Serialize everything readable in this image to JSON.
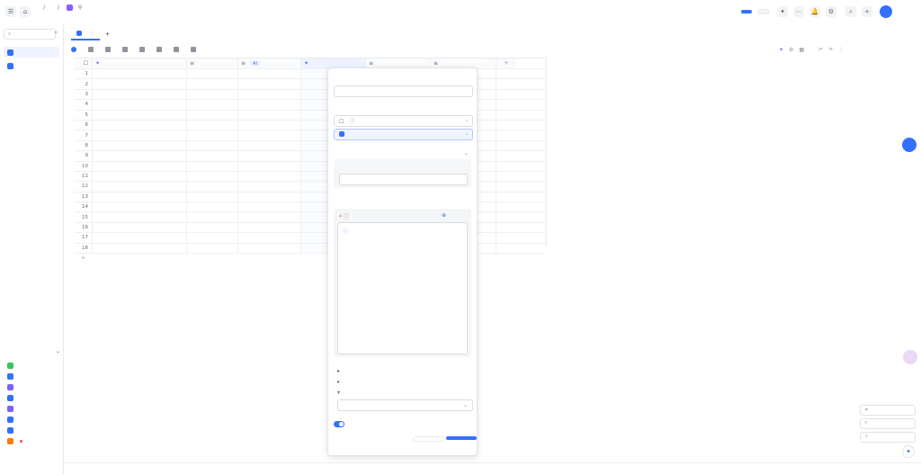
{
  "header": {
    "breadcrumb_1": "",
    "breadcrumb_2": "",
    "doc_title": "",
    "doc_subtitle_1": "",
    "doc_subtitle_2": "",
    "share_label": "",
    "auto_label": "",
    "user_avatar_text": ""
  },
  "sidebar": {
    "search_placeholder": "",
    "items": [
      {
        "label": ""
      },
      {
        "label": ""
      }
    ],
    "new_section_label": "",
    "new_items": [
      {
        "label": ""
      },
      {
        "label": ""
      },
      {
        "label": ""
      },
      {
        "label": ""
      },
      {
        "label": ""
      },
      {
        "label": ""
      },
      {
        "label": ""
      },
      {
        "label": ""
      }
    ]
  },
  "workarea": {
    "tab_active": "",
    "tab_new": "",
    "toolbar": [
      "",
      "",
      "",
      "",
      "",
      "",
      "",
      "",
      ""
    ],
    "toolbar_right": "",
    "columns": [
      "",
      "",
      "",
      "",
      "",
      ""
    ],
    "rows": [
      {
        "id": "1",
        "c1": "",
        "c2": "",
        "c3": "",
        "c6": ""
      },
      {
        "id": "2",
        "c1": "",
        "c2": "",
        "c3": "",
        "c6": ""
      },
      {
        "id": "3",
        "c1": "",
        "c2": "",
        "c3": "",
        "c6": ""
      },
      {
        "id": "4",
        "c1": "",
        "c2": "",
        "c3": "",
        "c6": ""
      },
      {
        "id": "5",
        "c1": "",
        "c2": "",
        "c3": "",
        "c6": ""
      },
      {
        "id": "6",
        "c1": "",
        "c2": "",
        "c3": "",
        "c6": ""
      },
      {
        "id": "7",
        "c1": "",
        "c2": "",
        "c3": "",
        "c6": ""
      },
      {
        "id": "8",
        "c1": "",
        "c2": "",
        "c3": "",
        "c6": ""
      },
      {
        "id": "9",
        "c1": "",
        "c2": "",
        "c3": "",
        "c6": ""
      },
      {
        "id": "10",
        "c1": "",
        "c2": "",
        "c3": "",
        "c6": ""
      },
      {
        "id": "11",
        "c1": "",
        "c2": "",
        "c3": "",
        "c6": ""
      },
      {
        "id": "12",
        "c1": "",
        "c2": "",
        "c3": "",
        "c6": ""
      },
      {
        "id": "13",
        "c1": "",
        "c2": "",
        "c3": "",
        "c6": ""
      },
      {
        "id": "14",
        "c1": "",
        "c2": "",
        "c3": "",
        "c6": ""
      },
      {
        "id": "15",
        "c1": "",
        "c2": "",
        "c3": "",
        "c6": ""
      },
      {
        "id": "16",
        "c1": "",
        "c2": "",
        "c3": "",
        "c6": ""
      },
      {
        "id": "17",
        "c1": "",
        "c2": "",
        "c3": "",
        "c6": ""
      },
      {
        "id": "18",
        "c1": "",
        "c2": "",
        "c3": "",
        "c6": ""
      }
    ],
    "record_count": ""
  },
  "panel": {
    "title_label": "",
    "title_value": "",
    "field_type_label": "",
    "type_option_1": "",
    "type_option_2": "",
    "type_option_2_tag": "",
    "related_label": "",
    "model_label": "",
    "model_link": "",
    "config_label": "",
    "prompt_label": "",
    "prompt_ref": "",
    "prompt_tag": "",
    "prompt_lines": [
      "",
      "",
      "",
      "",
      "",
      "",
      "",
      "",
      "",
      "",
      "",
      "",
      "",
      "",
      "",
      ""
    ],
    "collapsible": [
      "",
      "",
      ""
    ],
    "select_value": "",
    "more_info": "",
    "cancel": "",
    "confirm": ""
  },
  "right_cards": [
    "",
    "",
    ""
  ]
}
